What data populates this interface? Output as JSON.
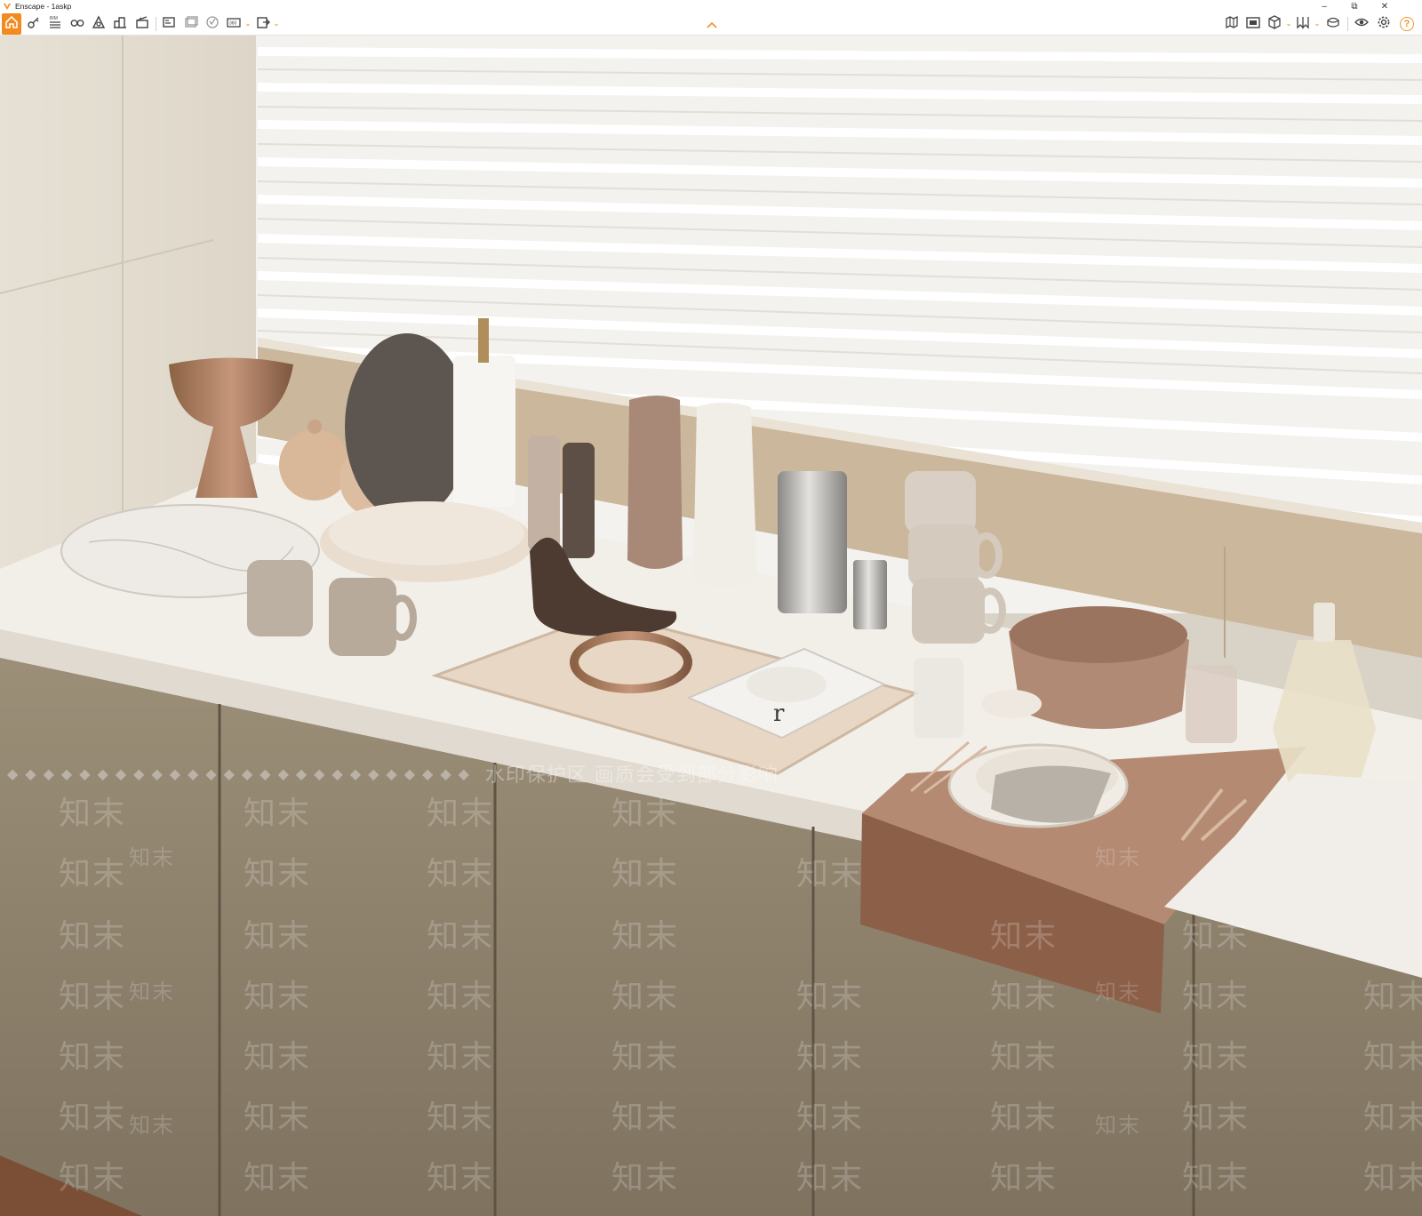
{
  "window": {
    "title": "Enscape - 1askp",
    "controls": {
      "minimize": "–",
      "restore": "⧉",
      "close": "✕"
    }
  },
  "toolbar": {
    "accent": "#f28a1e",
    "left_tools": [
      {
        "name": "home-icon",
        "label": ""
      },
      {
        "name": "settings-key-icon",
        "label": ""
      },
      {
        "name": "bim-icon",
        "label": "BIM"
      },
      {
        "name": "binoculars-icon",
        "label": ""
      },
      {
        "name": "site-icon",
        "label": ""
      },
      {
        "name": "buildings-icon",
        "label": ""
      },
      {
        "name": "clapperboard-icon",
        "label": ""
      },
      {
        "name": "screenshot-icon",
        "label": ""
      },
      {
        "name": "batch-render-icon",
        "label": ""
      },
      {
        "name": "vr-icon",
        "label": ""
      },
      {
        "name": "panorama-360-icon",
        "label": "360"
      },
      {
        "name": "export-icon",
        "label": ""
      }
    ],
    "right_tools": [
      {
        "name": "map-icon"
      },
      {
        "name": "asset-library-icon"
      },
      {
        "name": "cube-icon"
      },
      {
        "name": "views-icon"
      },
      {
        "name": "material-editor-icon"
      },
      {
        "name": "visibility-icon"
      },
      {
        "name": "visual-settings-icon"
      },
      {
        "name": "help-icon",
        "label": "?"
      }
    ]
  },
  "viewport": {
    "book_letter": "r",
    "watermark": {
      "logo_text": "知末",
      "banner": "水印保护区 画质会受到部分影响",
      "diamonds": "◆◆◆◆◆◆◆◆◆◆◆◆◆◆◆◆◆◆◆◆◆◆◆◆◆◆"
    }
  }
}
